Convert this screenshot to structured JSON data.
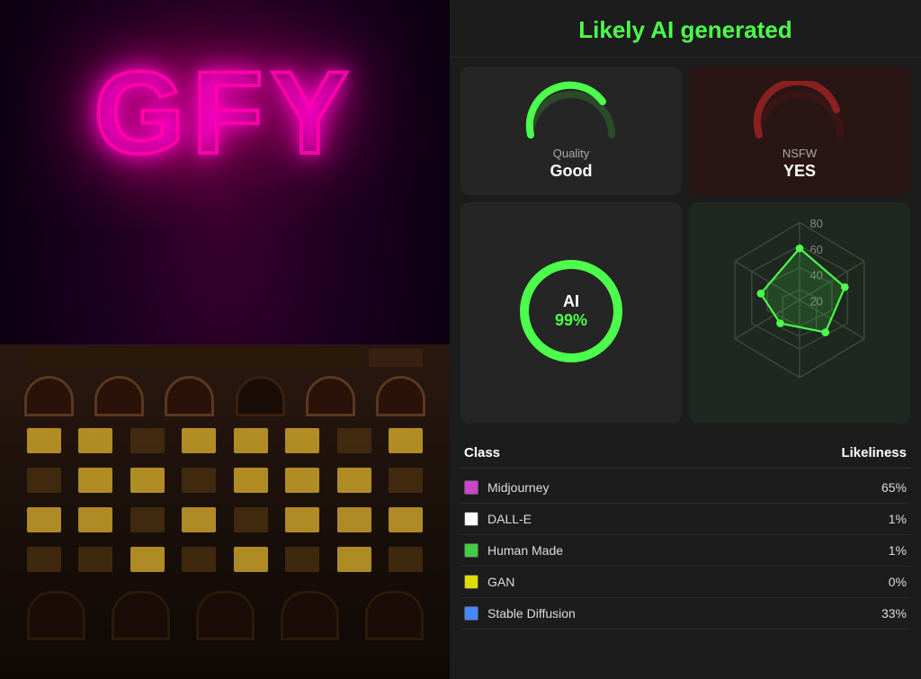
{
  "header": {
    "title": "Likely AI generated"
  },
  "metrics": {
    "quality": {
      "label": "Quality",
      "value": "Good",
      "gauge_pct": 75,
      "color": "#4cff4c",
      "track_color": "#2a4a2a"
    },
    "nsfw": {
      "label": "NSFW",
      "value": "YES",
      "gauge_pct": 85,
      "color": "#8b2020",
      "track_color": "#3a1515"
    },
    "ai": {
      "label": "AI",
      "pct": "99%",
      "value": 99,
      "color": "#4cff4c",
      "track_color": "#1a2a1a"
    }
  },
  "radar": {
    "labels": [
      "80",
      "60",
      "40",
      "20"
    ],
    "points": [
      {
        "x": 75,
        "y": 48
      },
      {
        "x": 88,
        "y": 65
      },
      {
        "x": 70,
        "y": 78
      }
    ]
  },
  "class_table": {
    "col_class": "Class",
    "col_likeliness": "Likeliness",
    "rows": [
      {
        "name": "Midjourney",
        "color": "#cc44cc",
        "pct": "65%"
      },
      {
        "name": "DALL-E",
        "color": "#ffffff",
        "pct": "1%"
      },
      {
        "name": "Human Made",
        "color": "#44cc44",
        "pct": "1%"
      },
      {
        "name": "GAN",
        "color": "#dddd00",
        "pct": "0%"
      },
      {
        "name": "Stable Diffusion",
        "color": "#4488ff",
        "pct": "33%"
      }
    ]
  }
}
